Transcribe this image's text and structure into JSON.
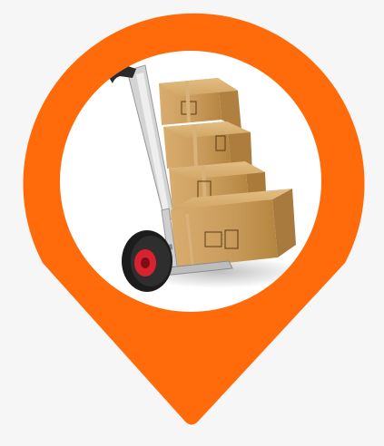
{
  "marker": {
    "icon": "map-pin-icon",
    "accent_color": "#ff6a0a",
    "inner_color": "#ffffff"
  },
  "illustration": {
    "subject": "hand-truck-with-boxes",
    "box_color": "#c89a5a",
    "box_shadow_color": "#a87a3e",
    "tape_color": "#d8b27a",
    "frame_color": "#cfcfcf",
    "wheel_color": "#1c1c1c",
    "hub_color": "#d8222e",
    "handle_color": "#2a2a2a"
  }
}
